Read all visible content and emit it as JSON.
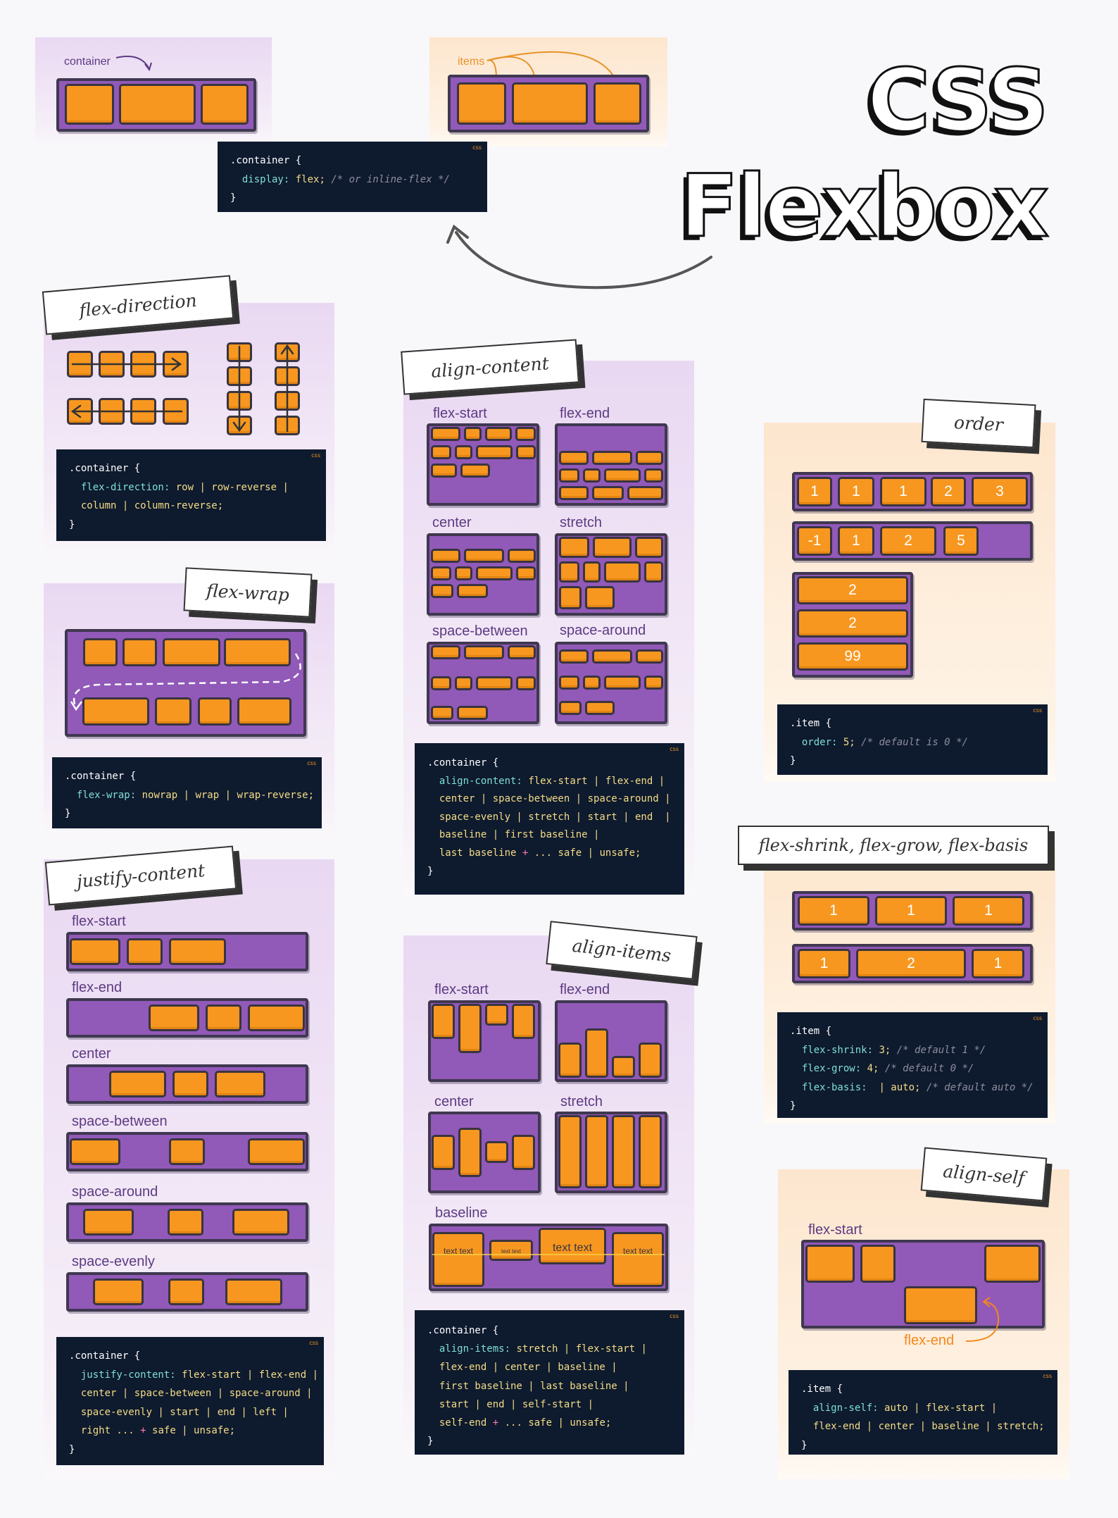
{
  "title": {
    "line1": "CSS",
    "line2": "Flexbox"
  },
  "intro": {
    "container_label": "container",
    "items_label": "items",
    "code": {
      "tag": "css",
      "selector": ".container {",
      "prop": "display:",
      "value": "flex;",
      "comment": "/* or inline-flex */",
      "close": "}"
    }
  },
  "flex_direction": {
    "heading": "flex-direction",
    "code": {
      "tag": "css",
      "selector": ".container {",
      "prop": "flex-direction:",
      "line1_values": "row | row-reverse |",
      "line2_values": "column | column-reverse;",
      "close": "}"
    }
  },
  "flex_wrap": {
    "heading": "flex-wrap",
    "code": {
      "tag": "css",
      "selector": ".container {",
      "prop": "flex-wrap:",
      "values": "nowrap | wrap | wrap-reverse;",
      "close": "}"
    }
  },
  "justify_content": {
    "heading": "justify-content",
    "labels": [
      "flex-start",
      "flex-end",
      "center",
      "space-between",
      "space-around",
      "space-evenly"
    ],
    "code": {
      "tag": "css",
      "selector": ".container {",
      "prop": "justify-content:",
      "line1_values": "flex-start | flex-end |",
      "line2_values": "center | space-between | space-around |",
      "line3_values": "space-evenly | start | end | left |",
      "line4_a": "right ...",
      "plus": "+",
      "line4_b": "safe | unsafe;",
      "close": "}"
    }
  },
  "align_content": {
    "heading": "align-content",
    "labels": [
      "flex-start",
      "flex-end",
      "center",
      "stretch",
      "space-between",
      "space-around"
    ],
    "code": {
      "tag": "css",
      "selector": ".container {",
      "prop": "align-content:",
      "line1_values": "flex-start | flex-end |",
      "line2_values": "center | space-between | space-around |",
      "line3_values": "space-evenly | stretch | start | end  |",
      "line4_values": "baseline | first baseline |",
      "line5_a": "last baseline",
      "plus": "+",
      "line5_b": "... safe | unsafe;",
      "close": "}"
    }
  },
  "align_items": {
    "heading": "align-items",
    "labels": [
      "flex-start",
      "flex-end",
      "center",
      "stretch",
      "baseline"
    ],
    "baseline_texts": [
      "text text",
      "text text",
      "text text",
      "text text"
    ],
    "code": {
      "tag": "css",
      "selector": ".container {",
      "prop": "align-items:",
      "line1_values": "stretch | flex-start |",
      "line2_values": "flex-end | center | baseline |",
      "line3_values": "first baseline | last baseline |",
      "line4_values": "start | end | self-start |",
      "line5_a": "self-end",
      "plus": "+",
      "line5_b": "... safe | unsafe;",
      "close": "}"
    }
  },
  "order": {
    "heading": "order",
    "row1": [
      "1",
      "1",
      "1",
      "2",
      "3"
    ],
    "row2": [
      "-1",
      "1",
      "2",
      "5"
    ],
    "column": [
      "2",
      "2",
      "99"
    ],
    "code": {
      "tag": "css",
      "selector": ".item {",
      "prop": "order:",
      "value": "5;",
      "comment": "/* default is 0 */",
      "close": "}"
    }
  },
  "flex_grow": {
    "heading": "flex-shrink, flex-grow, flex-basis",
    "row1": [
      "1",
      "1",
      "1"
    ],
    "row2": [
      "1",
      "2",
      "1"
    ],
    "code": {
      "tag": "css",
      "selector": ".item {",
      "prop1": "flex-shrink:",
      "val1": "3;",
      "com1": "/* default 1 */",
      "prop2": "flex-grow:",
      "val2": "4;",
      "com2": "/* default 0 */",
      "prop3": "flex-basis:",
      "val3": "| auto;",
      "com3": "/* default auto */",
      "close": "}"
    }
  },
  "align_self": {
    "heading": "align-self",
    "label_start": "flex-start",
    "label_end": "flex-end",
    "code": {
      "tag": "css",
      "selector": ".item {",
      "prop": "align-self:",
      "line1_values": "auto | flex-start |",
      "line2_values": "flex-end | center | baseline | stretch;",
      "close": "}"
    }
  },
  "colors": {
    "container": "#9159b8",
    "item": "#f7971f",
    "code_bg": "#0e1a2e",
    "outline": "#3a3440"
  }
}
